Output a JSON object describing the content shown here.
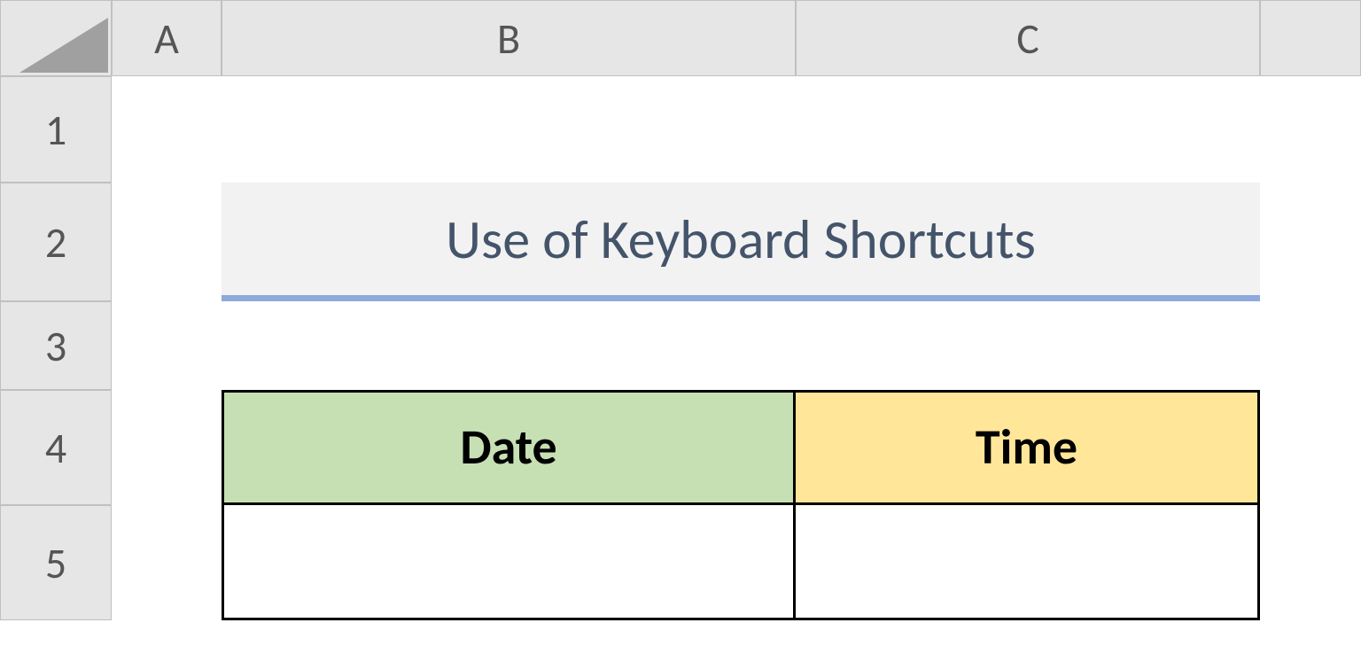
{
  "columns": [
    "A",
    "B",
    "C"
  ],
  "rows": [
    "1",
    "2",
    "3",
    "4",
    "5"
  ],
  "title": "Use of Keyboard Shortcuts",
  "table": {
    "headers": {
      "date": "Date",
      "time": "Time"
    },
    "cells": {
      "b5": "",
      "c5": ""
    }
  }
}
